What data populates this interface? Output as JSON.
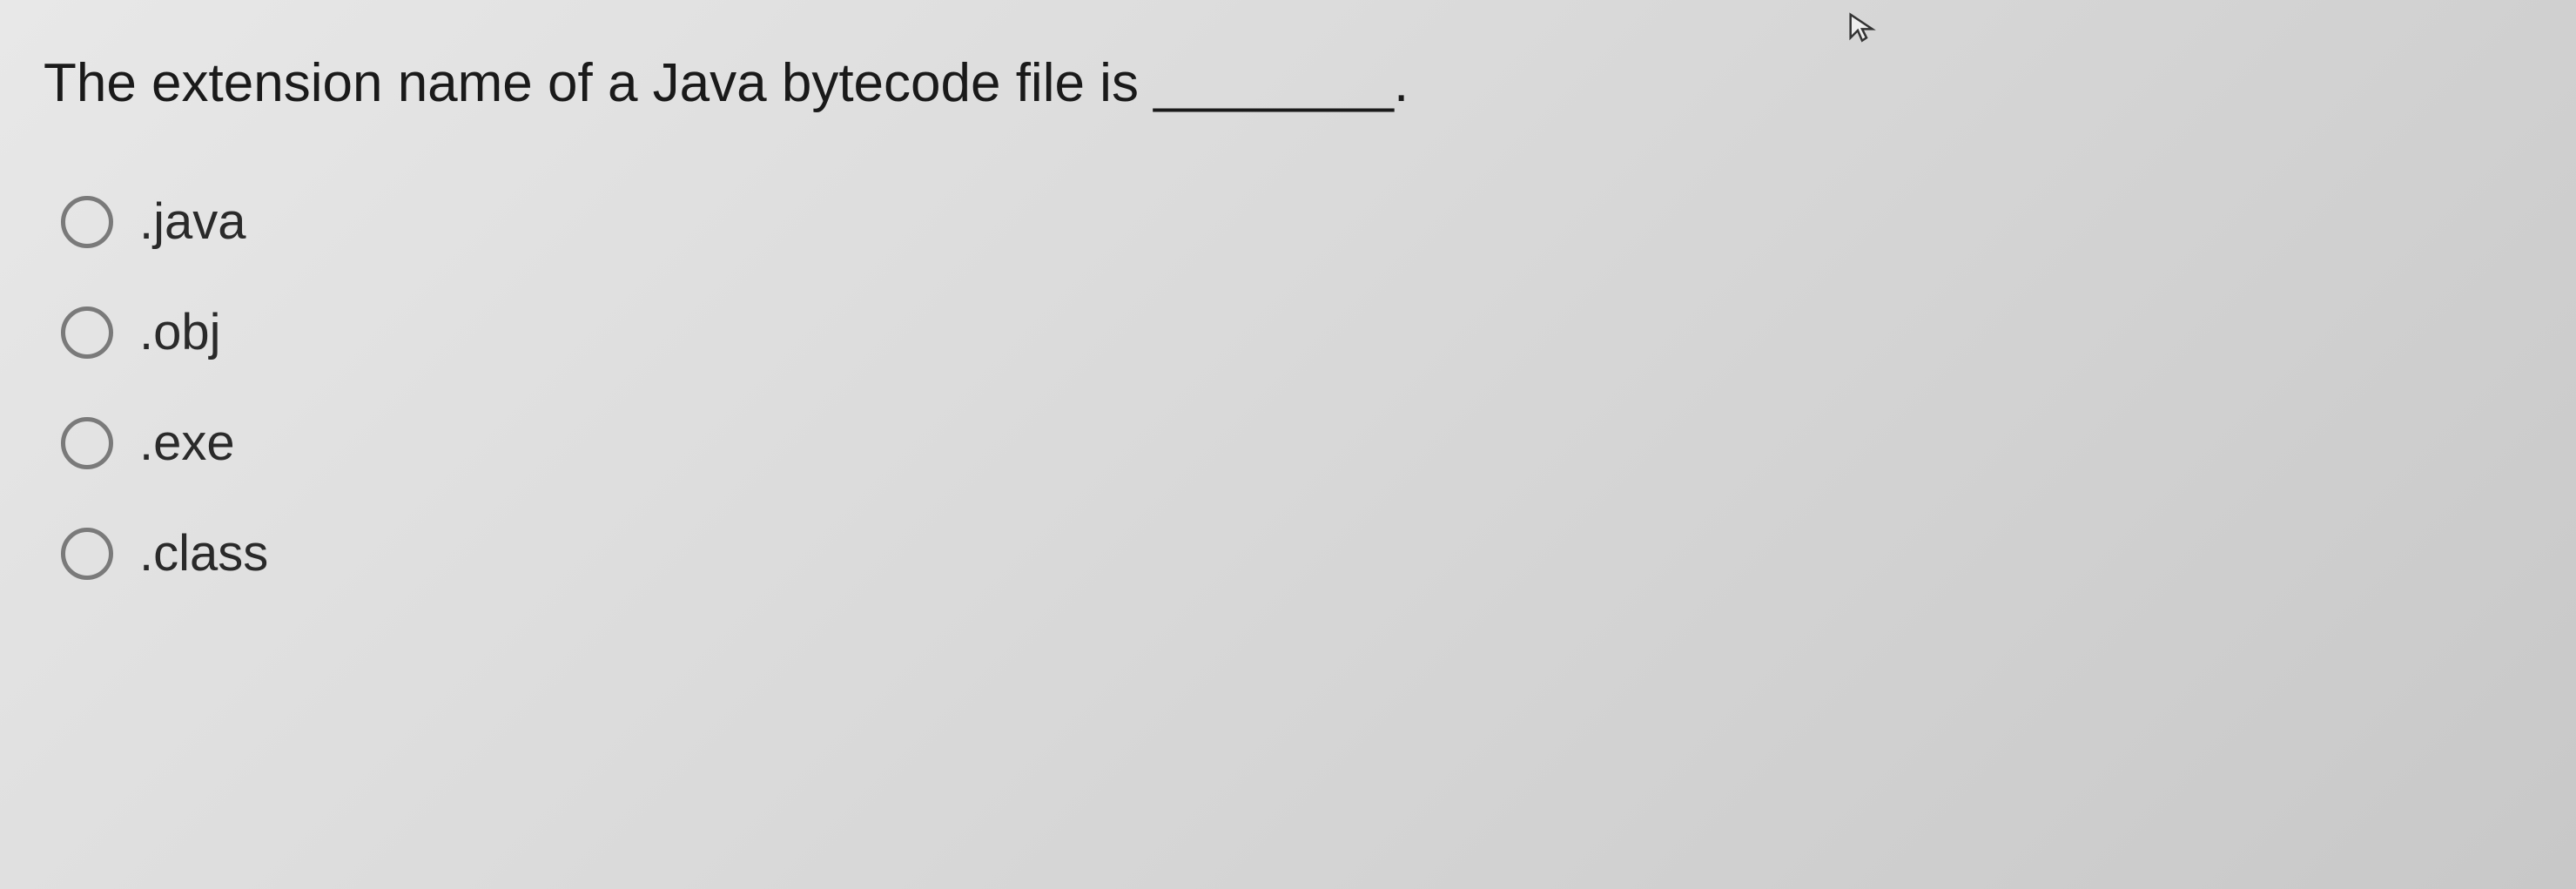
{
  "question": {
    "text": "The extension name of a Java bytecode file is ________."
  },
  "options": [
    {
      "label": ".java"
    },
    {
      "label": ".obj"
    },
    {
      "label": ".exe"
    },
    {
      "label": ".class"
    }
  ]
}
